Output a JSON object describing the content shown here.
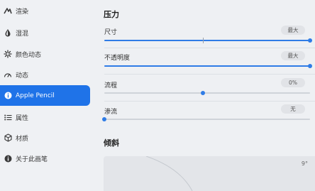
{
  "sidebar": {
    "items": [
      {
        "label": "渲染",
        "icon": "render-icon",
        "active": false
      },
      {
        "label": "湿混",
        "icon": "wet-mix-drop-icon",
        "active": false
      },
      {
        "label": "颜色动态",
        "icon": "color-dynamics-icon",
        "active": false
      },
      {
        "label": "动态",
        "icon": "dynamics-gauge-icon",
        "active": false
      },
      {
        "label": "Apple Pencil",
        "icon": "info-icon",
        "active": true
      },
      {
        "label": "属性",
        "icon": "properties-list-icon",
        "active": false
      },
      {
        "label": "材质",
        "icon": "material-cube-icon",
        "active": false
      },
      {
        "label": "关于此画笔",
        "icon": "about-info-icon",
        "active": false
      }
    ]
  },
  "pressure": {
    "title": "压力",
    "rows": [
      {
        "label": "尺寸",
        "value": "最大",
        "level": 1.0,
        "default_mark": 0.48
      },
      {
        "label": "不透明度",
        "value": "最大",
        "level": 1.0
      },
      {
        "label": "流程",
        "value": "0%",
        "level": 0.48
      },
      {
        "label": "渗流",
        "value": "无",
        "level": 0.0
      }
    ]
  },
  "tilt": {
    "title": "倾斜",
    "angle": "9°"
  },
  "colors": {
    "accent": "#1f73e8",
    "slider": "#2f7ce6"
  }
}
